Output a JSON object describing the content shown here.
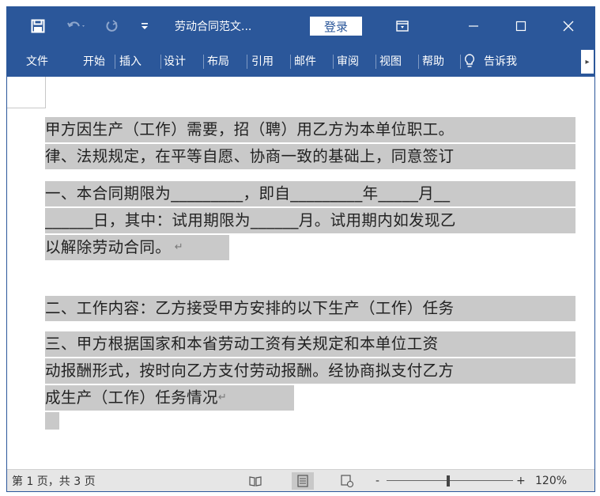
{
  "titlebar": {
    "doc_title": "劳动合同范文...",
    "login_label": "登录"
  },
  "tabs": {
    "items": [
      {
        "label": "文件"
      },
      {
        "label": "开始"
      },
      {
        "label": "插入"
      },
      {
        "label": "设计"
      },
      {
        "label": "布局"
      },
      {
        "label": "引用"
      },
      {
        "label": "邮件"
      },
      {
        "label": "审阅"
      },
      {
        "label": "视图"
      },
      {
        "label": "帮助"
      }
    ],
    "tell_me": "告诉我"
  },
  "document": {
    "lines": [
      "甲方因生产（工作）需要，招（聘）用乙方为本单位职工。",
      "律、法规规定，在平等自愿、协商一致的基础上，同意签订",
      "一、本合同期限为_________，即自_________年_____月__",
      "______日，其中：试用期限为______月。试用期内如发现乙",
      "以解除劳动合同。",
      "二、工作内容：乙方接受甲方安排的以下生产（工作）任务",
      "三、甲方根据国家和本省劳动工资有关规定和本单位工资",
      "动报酬形式，按时向乙方支付劳动报酬。经协商拟支付乙方",
      "成生产（工作）任务情况"
    ]
  },
  "statusbar": {
    "page_info": "第 1 页，共 3 页",
    "zoom_level": "120%",
    "zoom_minus": "-",
    "zoom_plus": "+"
  },
  "colors": {
    "accent": "#2b579a",
    "highlight": "#c9c9c9"
  },
  "icons": [
    "save-icon",
    "undo-icon",
    "redo-icon",
    "customize-quick-access-icon",
    "ribbon-display-options-icon",
    "minimize-icon",
    "maximize-icon",
    "close-icon",
    "lightbulb-icon",
    "read-mode-icon",
    "print-layout-icon",
    "web-layout-icon",
    "paragraph-mark-icon"
  ]
}
